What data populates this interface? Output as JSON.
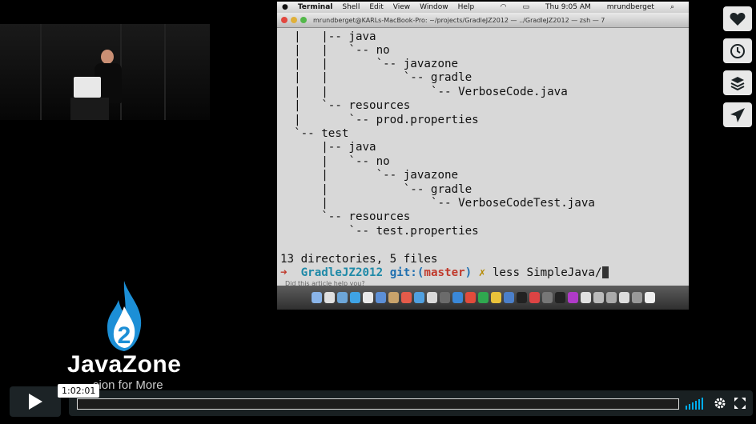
{
  "menubar": {
    "app": "Terminal",
    "items": [
      "Shell",
      "Edit",
      "View",
      "Window",
      "Help"
    ],
    "clock": "Thu 9:05 AM",
    "user": "mrundberget"
  },
  "window": {
    "title": "mrundberget@KARLs-MacBook-Pro: ~/projects/GradleJZ2012 — ../GradleJZ2012 — zsh — 7"
  },
  "terminal": {
    "lines": [
      "  |   |-- java",
      "  |   |   `-- no",
      "  |   |       `-- javazone",
      "  |   |           `-- gradle",
      "  |   |               `-- VerboseCode.java",
      "  |   `-- resources",
      "  |       `-- prod.properties",
      "  `-- test",
      "      |-- java",
      "      |   `-- no",
      "      |       `-- javazone",
      "      |           `-- gradle",
      "      |               `-- VerboseCodeTest.java",
      "      `-- resources",
      "          `-- test.properties",
      "",
      "13 directories, 5 files"
    ],
    "prompt": {
      "arrow": "➜",
      "repo": "GradleJZ2012",
      "git": "git:",
      "branch_open": "(",
      "branch": "master",
      "branch_close": ")",
      "dirty": "✗",
      "command": "less SimpleJava/"
    },
    "ghost_text": "Did this article help you?"
  },
  "logo": {
    "number": "2",
    "brand": "JavaZone",
    "tagline": "sion for More"
  },
  "actions": [
    {
      "name": "like-button",
      "icon": "heart-icon"
    },
    {
      "name": "watch-later-button",
      "icon": "clock-icon"
    },
    {
      "name": "collections-button",
      "icon": "layers-icon"
    },
    {
      "name": "share-button",
      "icon": "paper-plane-icon"
    }
  ],
  "player": {
    "timecode": "1:02:01",
    "accent": "#00adef",
    "progress": 0
  }
}
